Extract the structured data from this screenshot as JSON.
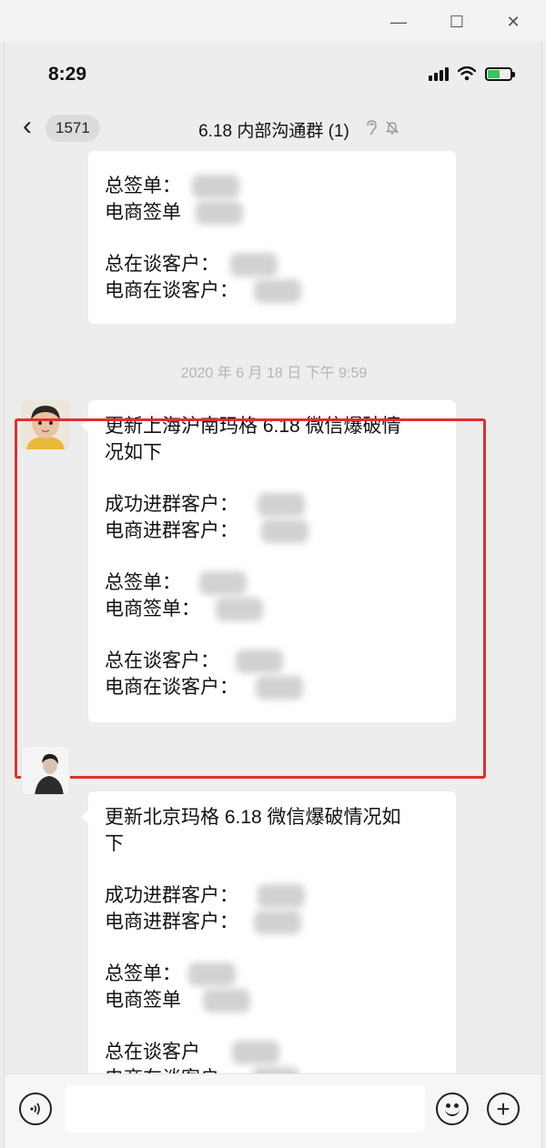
{
  "window": {
    "minimize": "—",
    "maximize": "☐",
    "close": "✕"
  },
  "status": {
    "time": "8:29"
  },
  "nav": {
    "back_arrow": "‹",
    "unread_count": "1571",
    "title": "6.18 内部沟通群 (1)",
    "icons": [
      "ear-icon",
      "mute-bell-icon"
    ]
  },
  "messages": [
    {
      "lines": [
        {
          "text": "总签单：",
          "blurred": true
        },
        {
          "text": "电商签单",
          "blurred": true
        },
        {
          "text": "",
          "gap": true
        },
        {
          "text": "总在谈客户：",
          "blurred": true
        },
        {
          "text": "电商在谈客户：",
          "blurred": true
        }
      ]
    },
    {
      "lines": [
        {
          "text": "更新上海沪南玛格 6.18 微信爆破情"
        },
        {
          "text": "况如下"
        },
        {
          "text": "",
          "gap": true
        },
        {
          "text": "成功进群客户：",
          "blurred": true
        },
        {
          "text": "电商进群客户：",
          "blurred": true
        },
        {
          "text": "",
          "gap": true
        },
        {
          "text": "总签单：",
          "blurred": true
        },
        {
          "text": "电商签单：",
          "blurred": true
        },
        {
          "text": "",
          "gap": true
        },
        {
          "text": "总在谈客户：",
          "blurred": true
        },
        {
          "text": "电商在谈客户：",
          "blurred": true
        }
      ]
    },
    {
      "lines": [
        {
          "text": "更新北京玛格 6.18 微信爆破情况如"
        },
        {
          "text": "下"
        },
        {
          "text": "",
          "gap": true
        },
        {
          "text": "成功进群客户：",
          "blurred": true
        },
        {
          "text": "电商进群客户：",
          "blurred": true
        },
        {
          "text": "",
          "gap": true
        },
        {
          "text": "总签单：",
          "blurred": true
        },
        {
          "text": "电商签单",
          "blurred": true
        },
        {
          "text": "",
          "gap": true
        },
        {
          "text": "总在谈客户",
          "blurred": true
        },
        {
          "text": "电商在谈客户",
          "blurred": true
        }
      ]
    }
  ],
  "timestamp": "2020 年 6 月 18 日 下午 9:59",
  "input": {
    "placeholder": "",
    "plus": "+",
    "voice": "◉"
  }
}
